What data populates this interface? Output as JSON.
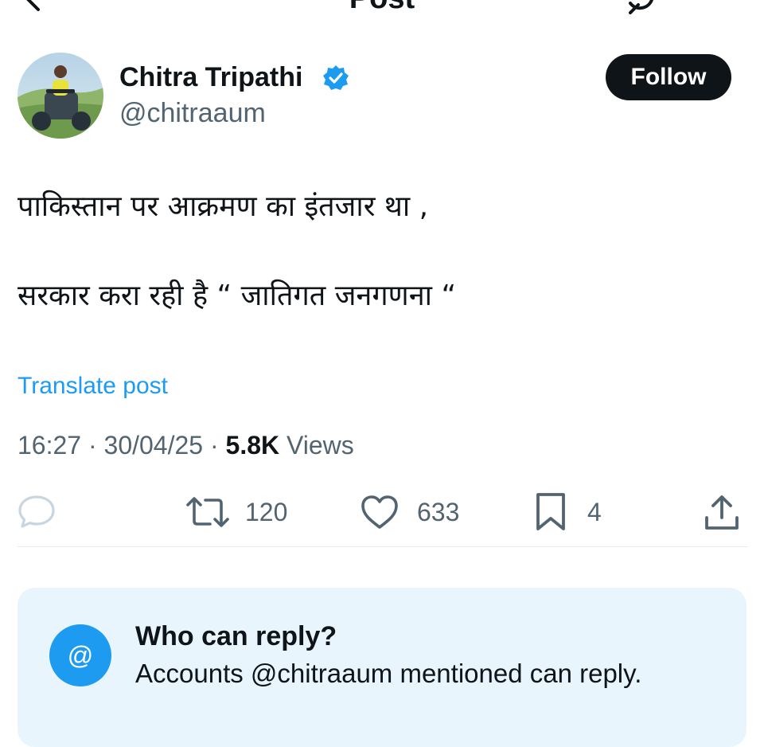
{
  "header": {
    "title": "Post",
    "back_icon": "back-arrow-icon",
    "grok_icon": "grok-icon"
  },
  "author": {
    "display_name": "Chitra Tripathi",
    "handle": "@chitraaum",
    "verified": true,
    "avatar_icon": "avatar",
    "follow_label": "Follow"
  },
  "post": {
    "lines": [
      "पाकिस्तान पर आक्रमण का इंतजार था ,",
      "सरकार करा रही है “ जातिगत जनगणना “"
    ],
    "translate_label": "Translate post"
  },
  "meta": {
    "time": "16:27",
    "separator": " · ",
    "date": "30/04/25",
    "views_count": "5.8K",
    "views_label": " Views"
  },
  "actions": {
    "reply": {
      "icon": "reply-icon",
      "count": ""
    },
    "repost": {
      "icon": "repost-icon",
      "count": "120"
    },
    "like": {
      "icon": "heart-icon",
      "count": "633"
    },
    "bookmark": {
      "icon": "bookmark-icon",
      "count": "4"
    },
    "share": {
      "icon": "share-icon"
    }
  },
  "reply_restriction": {
    "icon_glyph": "@",
    "title": "Who can reply?",
    "description": "Accounts @chitraaum mentioned can reply."
  },
  "colors": {
    "accent": "#1d9bf0",
    "text_primary": "#0f1419",
    "text_secondary": "#536471",
    "card_background": "#e8f5fd",
    "follow_button": "#0f1419"
  }
}
